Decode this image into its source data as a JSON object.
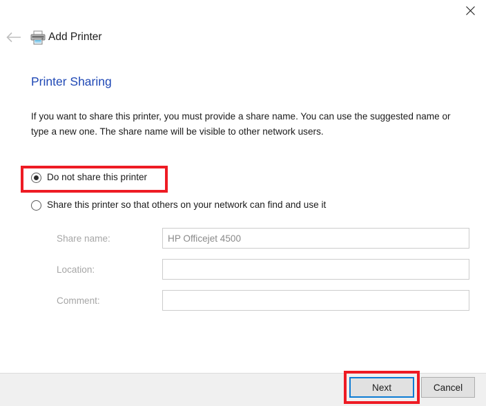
{
  "window": {
    "title": "Add Printer",
    "close_label": "✕",
    "back_label": "←",
    "printer_icon_name": "printer-icon"
  },
  "page": {
    "heading": "Printer Sharing",
    "intro": "If you want to share this printer, you must provide a share name. You can use the suggested name or type a new one. The share name will be visible to other network users.",
    "heading_color": "#1f48b5"
  },
  "options": {
    "no_share": {
      "label": "Do not share this printer",
      "selected": true
    },
    "share": {
      "label": "Share this printer so that others on your network can find and use it",
      "selected": false
    }
  },
  "fields": [
    {
      "label": "Share name:",
      "value": "HP Officejet 4500",
      "placeholder": ""
    },
    {
      "label": "Location:",
      "value": "",
      "placeholder": ""
    },
    {
      "label": "Comment:",
      "value": "",
      "placeholder": ""
    }
  ],
  "footer": {
    "next_label": "Next",
    "cancel_label": "Cancel"
  },
  "annotations": {
    "highlight_color": "#ee1b24",
    "focus_color": "#0b7bd4",
    "highlighted_items": [
      "Do not share this printer",
      "Next"
    ]
  }
}
